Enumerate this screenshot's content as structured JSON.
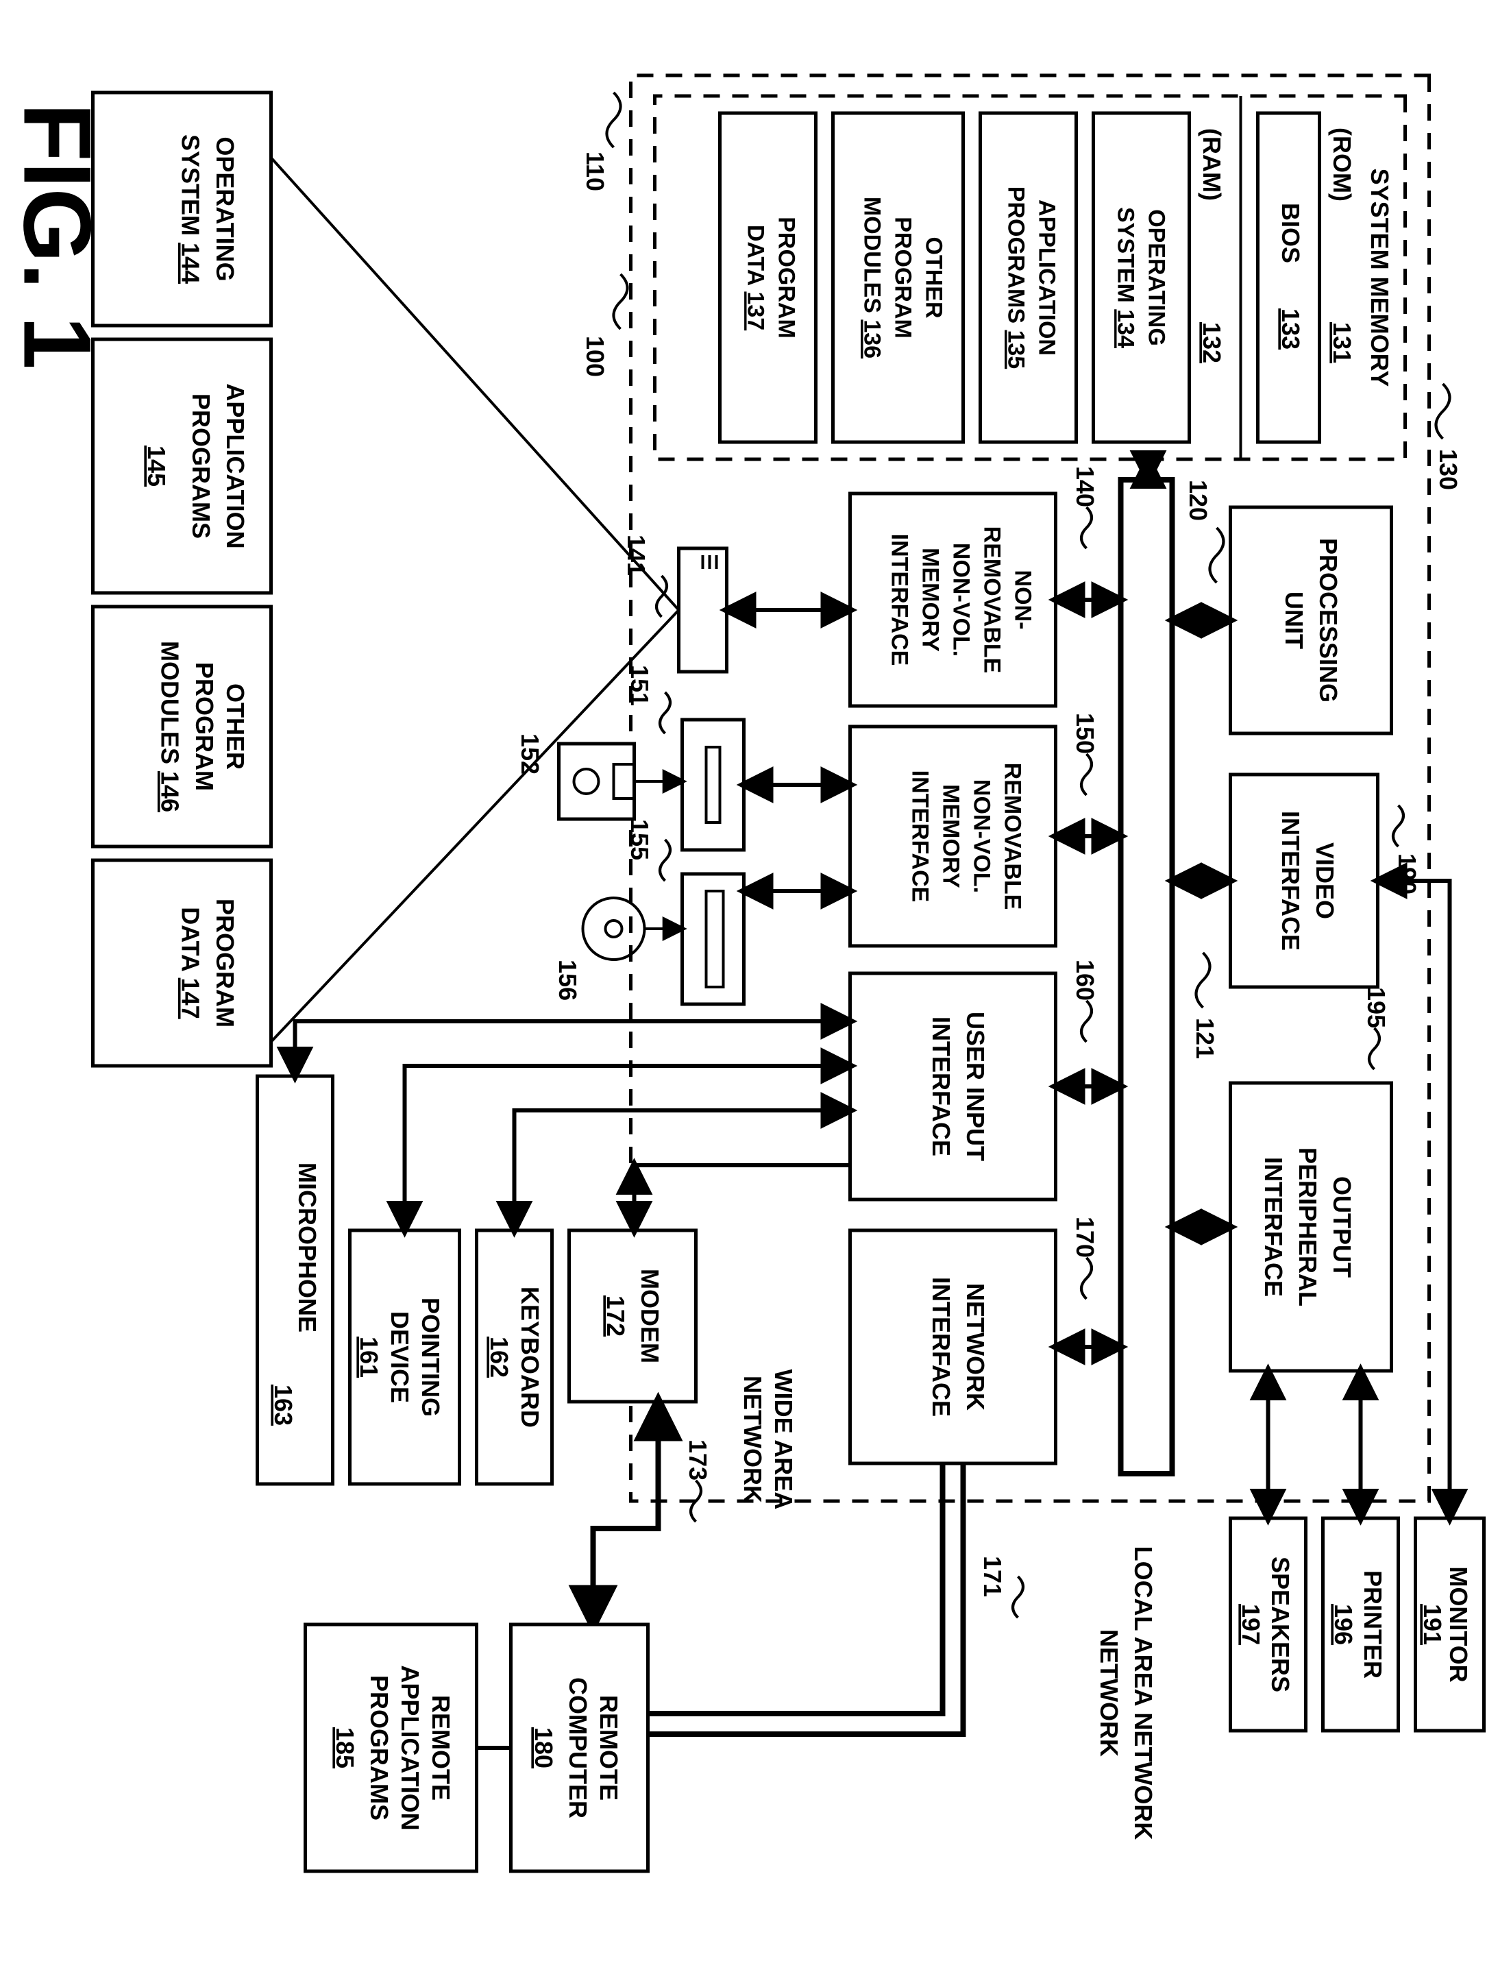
{
  "figure_label": "FIG. 1",
  "boundary": {
    "ref": "110",
    "computer_ref": "100"
  },
  "system_memory": {
    "title": "SYSTEM MEMORY",
    "rom": {
      "label": "(ROM)",
      "ref": "131"
    },
    "bios": {
      "label": "BIOS",
      "ref": "133"
    },
    "ram": {
      "label": "(RAM)",
      "ref": "132"
    },
    "os": {
      "label": "OPERATING SYSTEM",
      "ref": "134"
    },
    "apps": {
      "label": "APPLICATION PROGRAMS",
      "ref": "135"
    },
    "mods": {
      "label": "OTHER PROGRAM MODULES",
      "ref": "136"
    },
    "data": {
      "label": "PROGRAM DATA",
      "ref": "137"
    },
    "ref": "130"
  },
  "processing_unit": {
    "label": "PROCESSING UNIT",
    "ref": "120"
  },
  "video_if": {
    "label": "VIDEO INTERFACE",
    "ref": "190"
  },
  "out_periph": {
    "label": "OUTPUT PERIPHERAL INTERFACE",
    "ref": "195"
  },
  "bus_ref": "121",
  "nonrem_if": {
    "label": "NON-REMOVABLE NON-VOL. MEMORY INTERFACE",
    "ref": "140"
  },
  "rem_if": {
    "label": "REMOVABLE NON-VOL. MEMORY INTERFACE",
    "ref": "150"
  },
  "user_if": {
    "label": "USER INPUT INTERFACE",
    "ref": "160"
  },
  "net_if": {
    "label": "NETWORK INTERFACE",
    "ref": "170"
  },
  "monitor": {
    "label": "MONITOR",
    "ref": "191"
  },
  "printer": {
    "label": "PRINTER",
    "ref": "196"
  },
  "speakers": {
    "label": "SPEAKERS",
    "ref": "197"
  },
  "lan": {
    "label": "LOCAL AREA NETWORK",
    "ref": "171"
  },
  "wan": {
    "label": "WIDE AREA NETWORK",
    "ref": "173"
  },
  "modem": {
    "label": "MODEM",
    "ref": "172"
  },
  "keyboard": {
    "label": "KEYBOARD",
    "ref": "162"
  },
  "pointing": {
    "label": "POINTING DEVICE",
    "ref": "161"
  },
  "mic": {
    "label": "MICROPHONE",
    "ref": "163"
  },
  "remote_comp": {
    "label": "REMOTE COMPUTER",
    "ref": "180"
  },
  "remote_apps": {
    "label": "REMOTE APPLICATION PROGRAMS",
    "ref": "185"
  },
  "drives": {
    "hdd": "141",
    "floppy_drive": "151",
    "floppy": "152",
    "optical_drive": "155",
    "disc": "156"
  },
  "disk_sw": {
    "os": {
      "label": "OPERATING SYSTEM",
      "ref": "144"
    },
    "apps": {
      "label": "APPLICATION PROGRAMS",
      "ref": "145"
    },
    "mods": {
      "label": "OTHER PROGRAM MODULES",
      "ref": "146"
    },
    "data": {
      "label": "PROGRAM DATA",
      "ref": "147"
    }
  }
}
